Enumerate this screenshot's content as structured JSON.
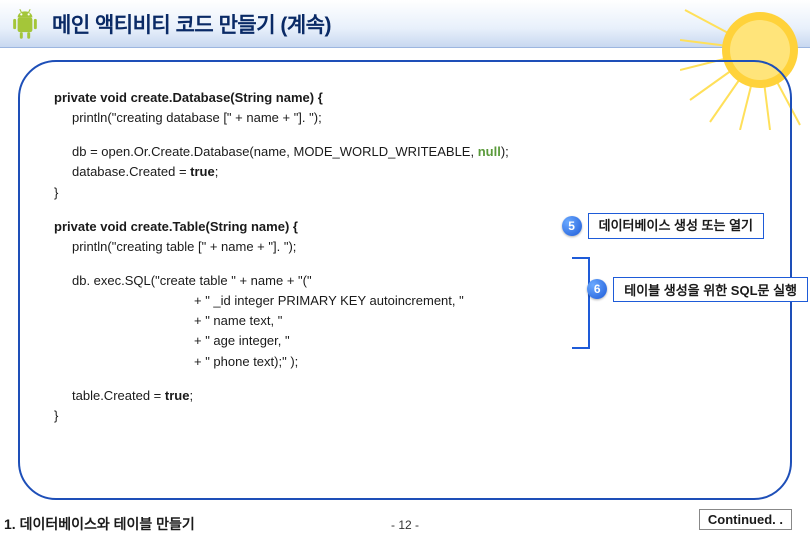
{
  "header": {
    "title": "메인 액티비티 코드 만들기 (계속)",
    "icon_name": "android-icon"
  },
  "code": {
    "createDatabase_sig": "private void create.Database(String name) {",
    "createDatabase_l1": "println(\"creating database [\" + name + \"]. \");",
    "createDatabase_l2_a": "db = open.Or.Create.Database(name, MODE_WORLD_WRITEABLE, ",
    "createDatabase_l2_b": "null",
    "createDatabase_l2_c": ");",
    "createDatabase_l3": "database.Created = true;",
    "createDatabase_close": "}",
    "createTable_sig": "private void create.Table(String name) {",
    "createTable_l1": "println(\"creating table [\" + name + \"]. \");",
    "execSQL_l1": "db. exec.SQL(\"create table \" + name + \"(\"",
    "execSQL_l2": "+ \" _id integer PRIMARY KEY autoincrement, \"",
    "execSQL_l3": "+ \" name text, \"",
    "execSQL_l4": "+ \" age integer, \"",
    "execSQL_l5": "+ \" phone text);\" );",
    "tableCreated": "table.Created = true;",
    "close2": "}"
  },
  "callouts": {
    "c5_num": "5",
    "c5_label": "데이터베이스 생성 또는 열기",
    "c6_num": "6",
    "c6_label": "테이블 생성을 위한 SQL문 실행"
  },
  "footer": {
    "left": "1. 데이터베이스와 테이블 만들기",
    "center": "- 12 -",
    "right": "Continued. ."
  }
}
